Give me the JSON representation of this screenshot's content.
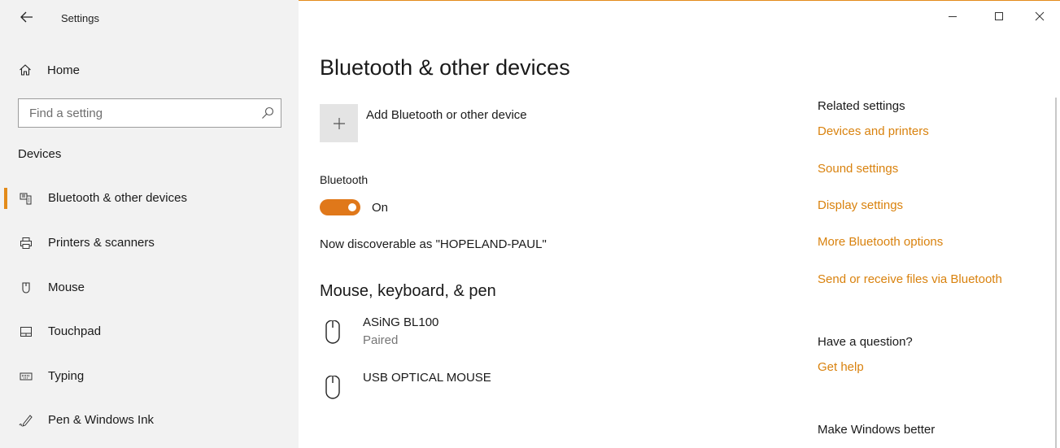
{
  "window": {
    "title": "Settings",
    "controls": {
      "minimize": "—",
      "maximize": "☐",
      "close": "✕"
    },
    "accent": "#e38b1a"
  },
  "sidebar": {
    "home_label": "Home",
    "search_placeholder": "Find a setting",
    "section": "Devices",
    "items": [
      {
        "label": "Bluetooth & other devices",
        "icon": "bluetooth-devices-icon",
        "selected": true
      },
      {
        "label": "Printers & scanners",
        "icon": "printer-icon",
        "selected": false
      },
      {
        "label": "Mouse",
        "icon": "mouse-icon",
        "selected": false
      },
      {
        "label": "Touchpad",
        "icon": "touchpad-icon",
        "selected": false
      },
      {
        "label": "Typing",
        "icon": "keyboard-icon",
        "selected": false
      },
      {
        "label": "Pen & Windows Ink",
        "icon": "pen-icon",
        "selected": false
      }
    ]
  },
  "main": {
    "title": "Bluetooth & other devices",
    "add_device_label": "Add Bluetooth or other device",
    "bluetooth_label": "Bluetooth",
    "bluetooth_state": "On",
    "bluetooth_on": true,
    "discoverable_text": "Now discoverable as \"HOPELAND-PAUL\"",
    "group_title": "Mouse, keyboard, & pen",
    "devices": [
      {
        "name": "ASiNG BL100",
        "status": "Paired",
        "icon": "mouse-icon"
      },
      {
        "name": "USB OPTICAL MOUSE",
        "status": "",
        "icon": "mouse-icon"
      }
    ]
  },
  "related": {
    "heading": "Related settings",
    "links": [
      "Devices and printers",
      "Sound settings",
      "Display settings",
      "More Bluetooth options",
      "Send or receive files via Bluetooth"
    ],
    "question_heading": "Have a question?",
    "help_link": "Get help",
    "feedback_heading": "Make Windows better",
    "link_color": "#d9820e"
  }
}
